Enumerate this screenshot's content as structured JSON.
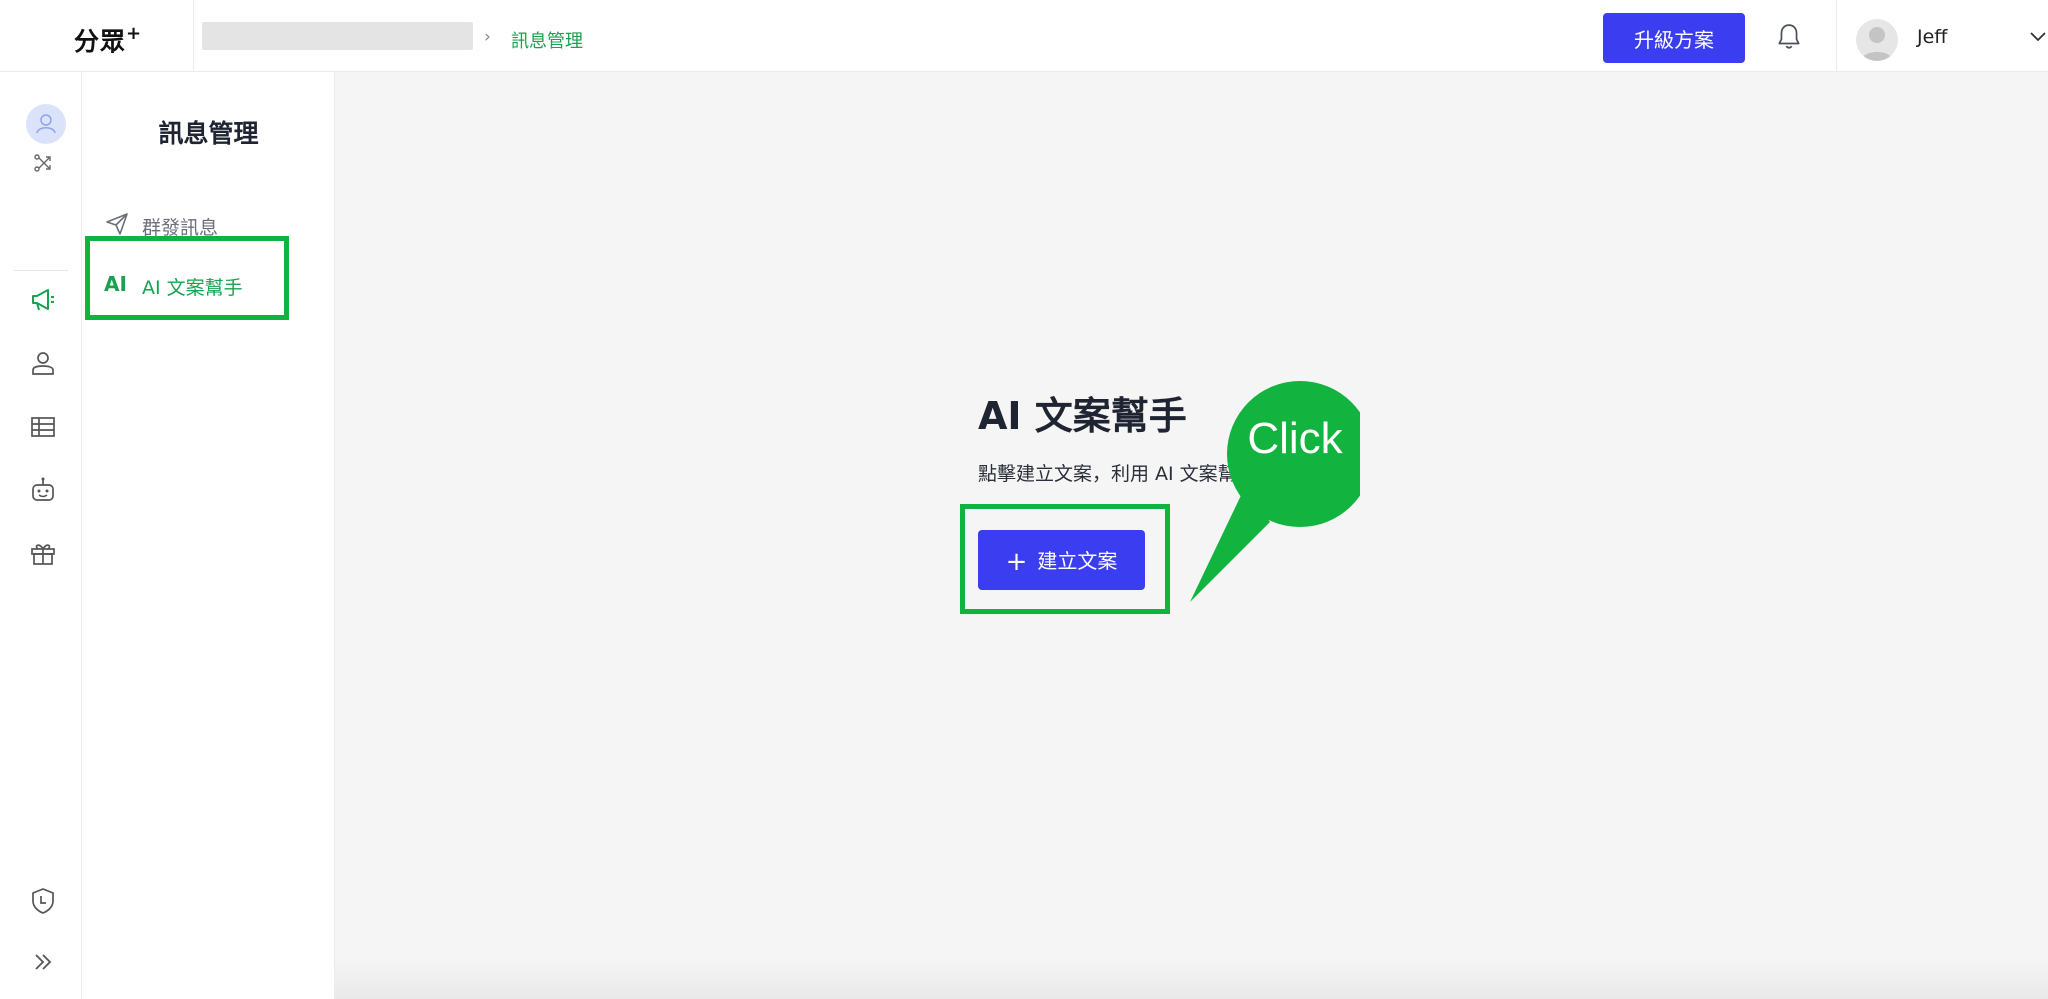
{
  "app": {
    "logo": "分眾",
    "logo_sup": "+"
  },
  "breadcrumb": {
    "separator": "›",
    "current": "訊息管理"
  },
  "header": {
    "upgrade_label": "升級方案",
    "user_name": "Jeff"
  },
  "rail": {
    "items": [
      "user-icon",
      "flow-icon",
      "megaphone-icon",
      "person-icon",
      "table-icon",
      "robot-icon",
      "gift-icon",
      "shield-clock-icon",
      "expand-icon"
    ],
    "active": "megaphone-icon"
  },
  "subnav": {
    "title": "訊息管理",
    "items": [
      {
        "label": "群發訊息",
        "icon": "send-icon"
      },
      {
        "label": "AI 文案幫手",
        "icon_text": "AI"
      }
    ],
    "active_index": 1
  },
  "main": {
    "title": "AI 文案幫手",
    "description": "點擊建立文案，利用 AI 文案幫手撰寫文案吧！",
    "create_label": "建立文案",
    "create_plus": "+"
  },
  "annotation": {
    "callout_text": "Click"
  },
  "colors": {
    "accent": "#3a3ef0",
    "active_green": "#1aa150",
    "highlight": "#0fb33f"
  }
}
